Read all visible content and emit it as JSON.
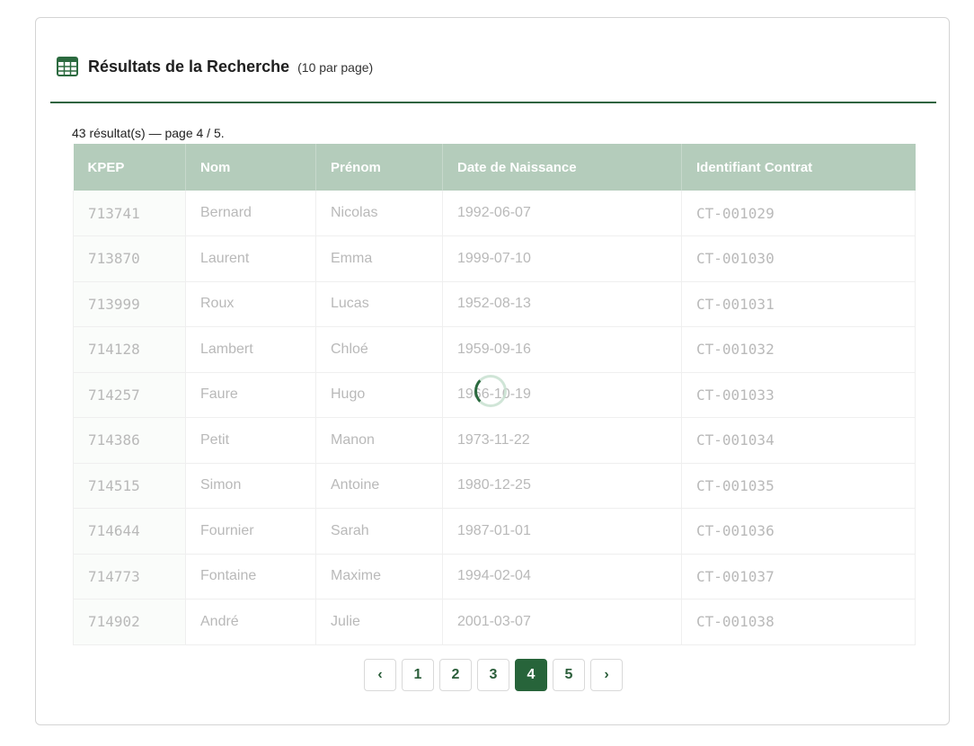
{
  "header": {
    "icon": "table-icon",
    "title": "Résultats de la Recherche",
    "subtitle": "(10 par page)"
  },
  "summary": "43 résultat(s) — page 4 / 5.",
  "table": {
    "columns": [
      "KPEP",
      "Nom",
      "Prénom",
      "Date de Naissance",
      "Identifiant Contrat"
    ],
    "rows": [
      [
        "713741",
        "Bernard",
        "Nicolas",
        "1992-06-07",
        "CT-001029"
      ],
      [
        "713870",
        "Laurent",
        "Emma",
        "1999-07-10",
        "CT-001030"
      ],
      [
        "713999",
        "Roux",
        "Lucas",
        "1952-08-13",
        "CT-001031"
      ],
      [
        "714128",
        "Lambert",
        "Chloé",
        "1959-09-16",
        "CT-001032"
      ],
      [
        "714257",
        "Faure",
        "Hugo",
        "1966-10-19",
        "CT-001033"
      ],
      [
        "714386",
        "Petit",
        "Manon",
        "1973-11-22",
        "CT-001034"
      ],
      [
        "714515",
        "Simon",
        "Antoine",
        "1980-12-25",
        "CT-001035"
      ],
      [
        "714644",
        "Fournier",
        "Sarah",
        "1987-01-01",
        "CT-001036"
      ],
      [
        "714773",
        "Fontaine",
        "Maxime",
        "1994-02-04",
        "CT-001037"
      ],
      [
        "714902",
        "André",
        "Julie",
        "2001-03-07",
        "CT-001038"
      ]
    ]
  },
  "pagination": {
    "prev": "‹",
    "next": "›",
    "pages": [
      "1",
      "2",
      "3",
      "4",
      "5"
    ],
    "current": "4"
  },
  "colors": {
    "accent": "#27643a",
    "header_bg": "#b4ccbb"
  }
}
